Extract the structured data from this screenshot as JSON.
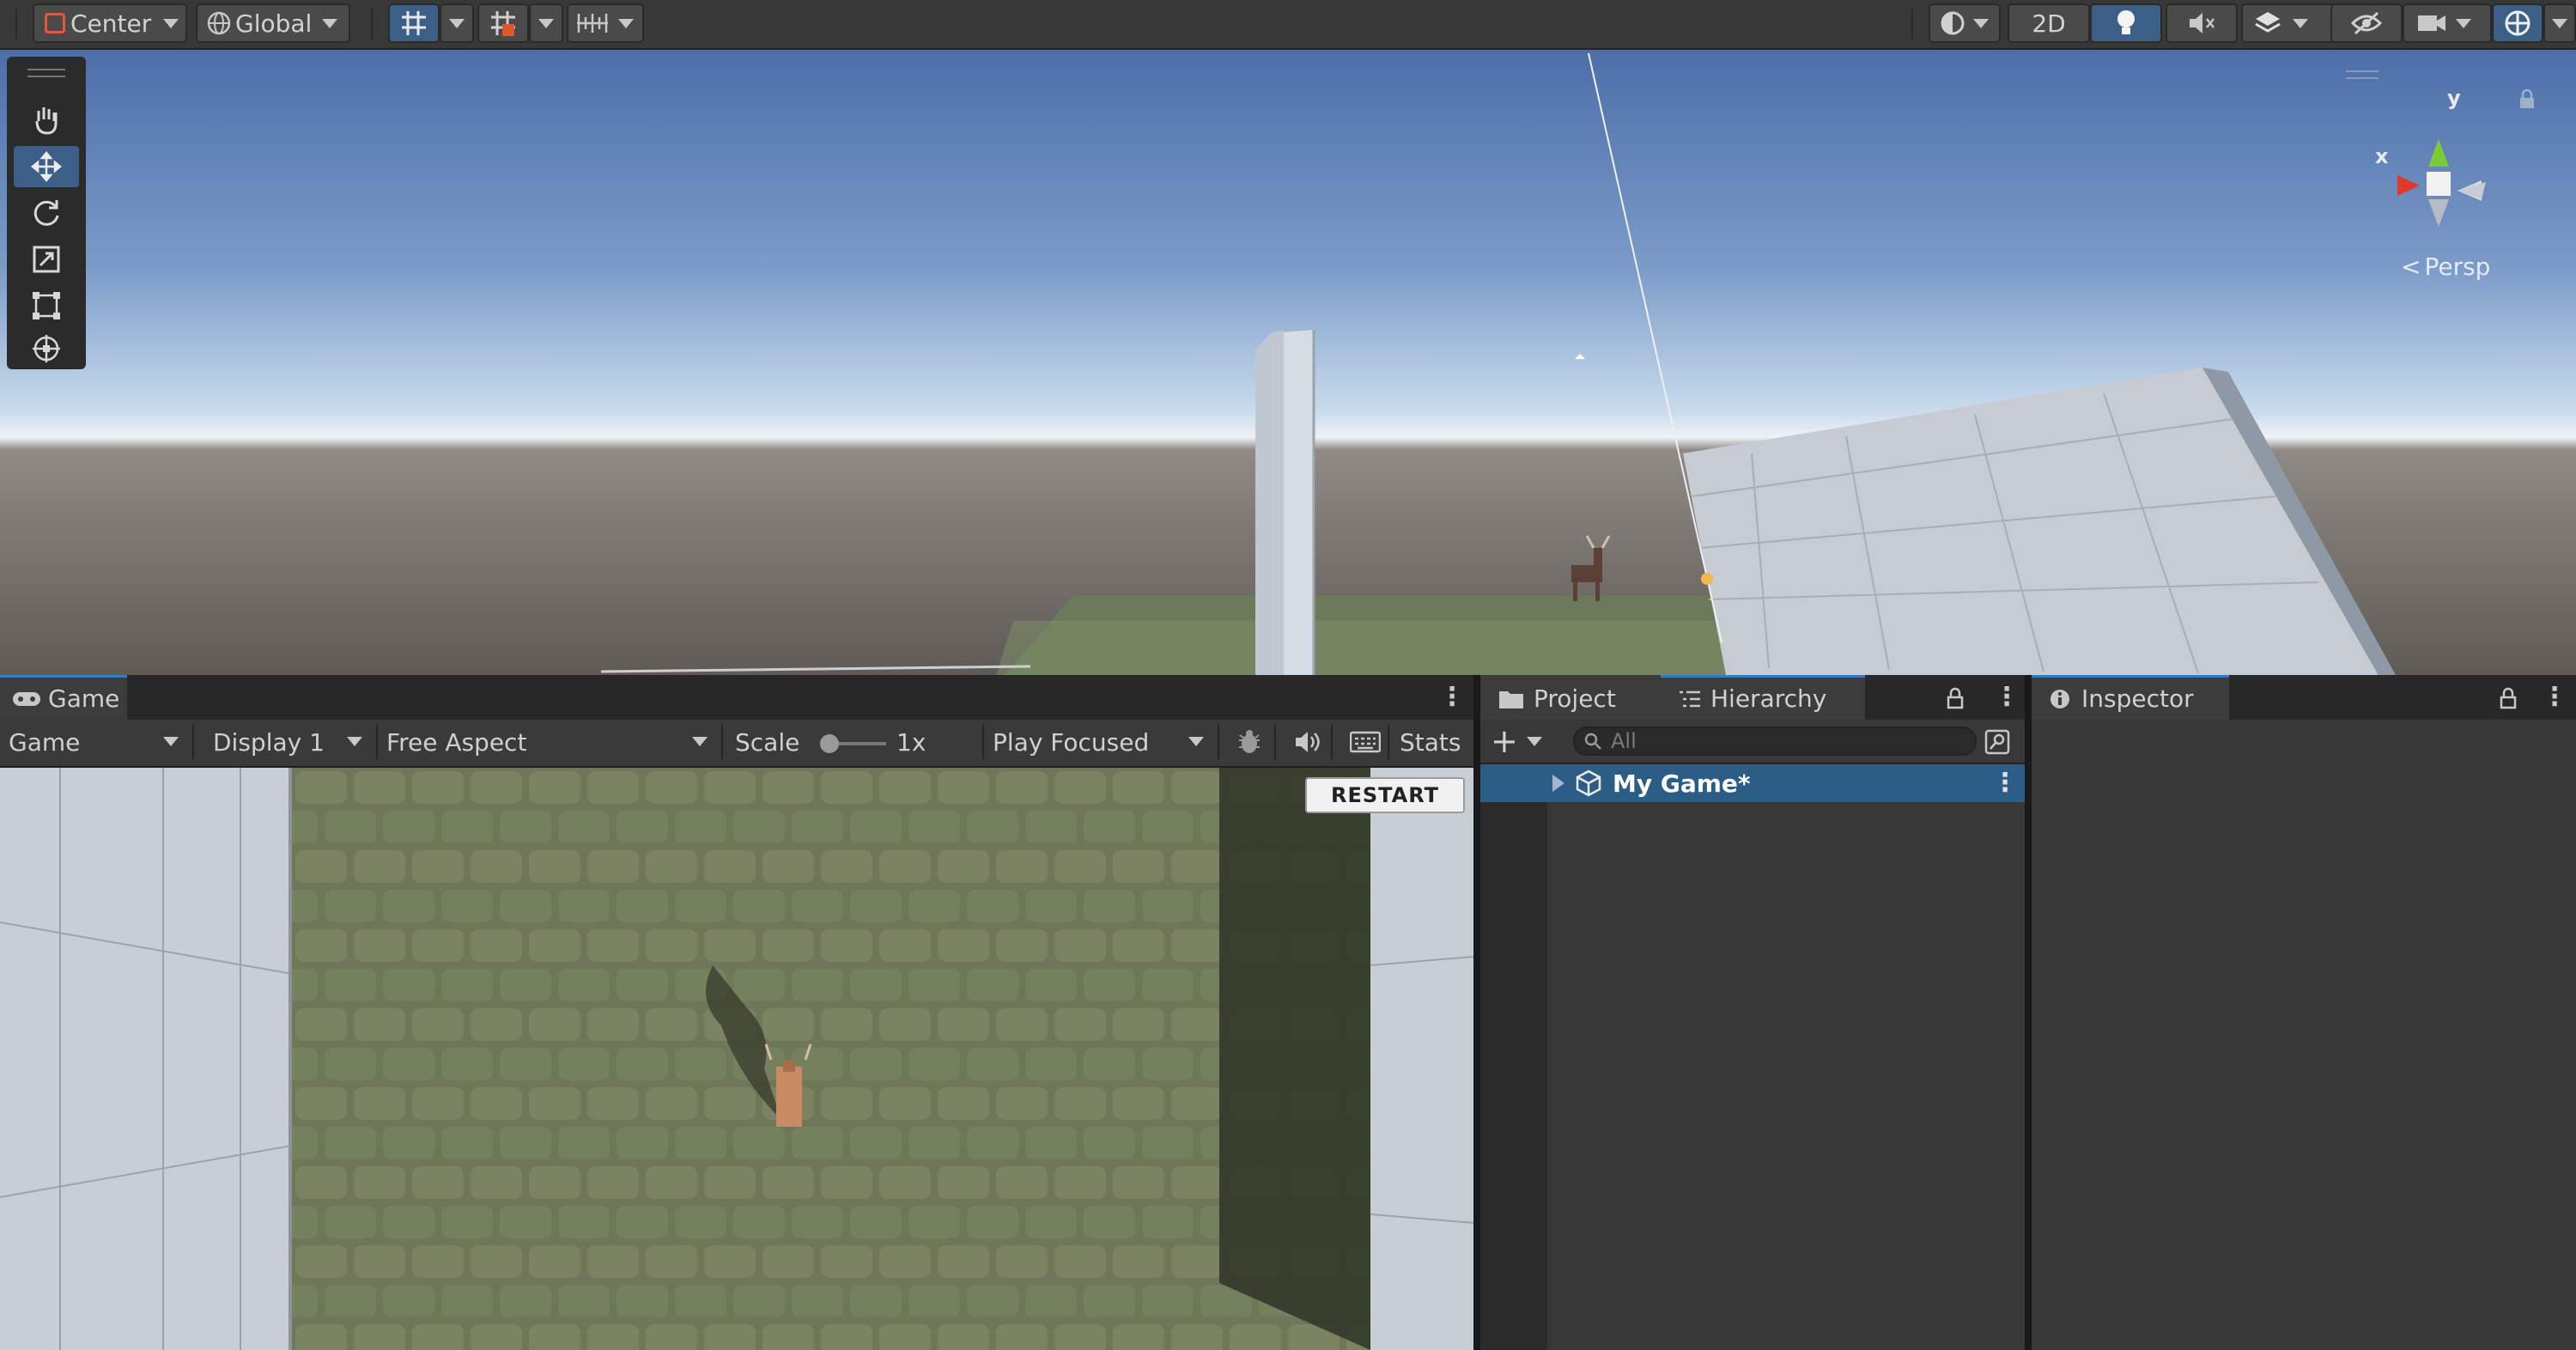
{
  "toolbar": {
    "pivot_mode": "Center",
    "pivot_rotation": "Global",
    "view_2d": "2D",
    "icons": [
      "grid-snap-icon",
      "grid-visibility-icon",
      "increment-snap-icon",
      "shading-mode-icon",
      "lighting-icon",
      "audio-mute-icon",
      "effects-icon",
      "scene-visibility-icon",
      "camera-icon",
      "gizmos-icon"
    ]
  },
  "scene": {
    "tools": [
      "hand-tool-icon",
      "move-tool-icon",
      "rotate-tool-icon",
      "scale-tool-icon",
      "rect-tool-icon",
      "transform-tool-icon"
    ],
    "active_tool": "move-tool-icon",
    "gizmo": {
      "y_label": "y",
      "x_label": "x",
      "projection": "Persp"
    }
  },
  "game_panel": {
    "tab_label": "Game",
    "view_select": "Game",
    "display_select": "Display 1",
    "aspect_select": "Free Aspect",
    "scale_label": "Scale",
    "scale_value": "1x",
    "play_mode_select": "Play Focused",
    "stats_label": "Stats",
    "restart_label": "RESTART"
  },
  "project_panel": {
    "project_tab_label": "Project",
    "hierarchy_tab_label": "Hierarchy",
    "search_placeholder": "All",
    "scene_item": "My Game*"
  },
  "inspector_panel": {
    "tab_label": "Inspector"
  },
  "colors": {
    "accent": "#3a79bb",
    "selection": "#2c5d87",
    "toolbar_bg": "#383838",
    "panel_bg": "#383838",
    "gizmo_x": "#e0392b",
    "gizmo_y": "#7ecb3a"
  }
}
